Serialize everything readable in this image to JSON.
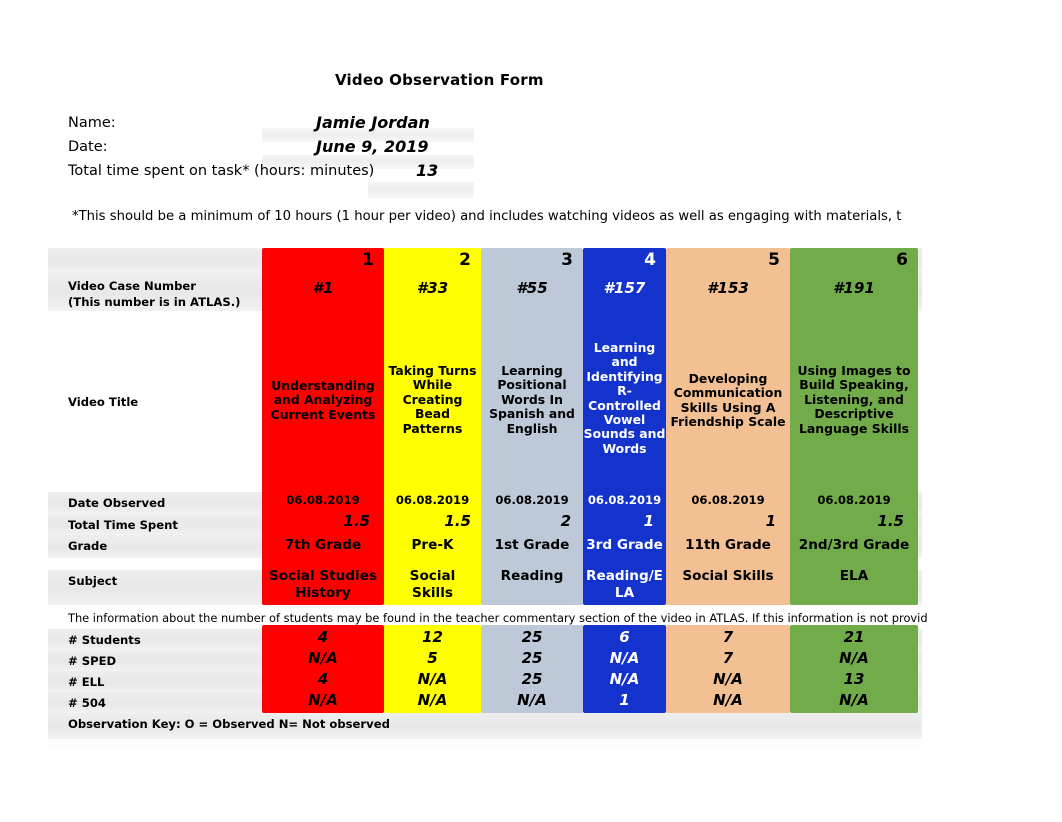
{
  "header": {
    "title": "Video Observation Form",
    "name_label": "Name:",
    "name_value": "Jamie Jordan",
    "date_label": "Date:",
    "date_value": "June 9, 2019",
    "time_label": "Total time spent on task* (hours: minutes)",
    "time_value": "13",
    "footnote": "*This should be a minimum of 10 hours (1 hour per video) and includes watching videos as well as engaging with materials, t"
  },
  "table": {
    "row_labels": {
      "case_number_l1": "Video Case Number",
      "case_number_l2": "(This number is in ATLAS.)",
      "video_title": "Video Title",
      "date_observed": "Date Observed",
      "total_time_spent": "Total Time Spent",
      "grade": "Grade",
      "subject": "Subject",
      "students_note": "The information about the number of students may be found in the teacher commentary section of the video in ATLAS. If this information is not provided, ple",
      "students": "# Students",
      "sped": "# SPED",
      "ell": "# ELL",
      "f504": "# 504",
      "observation_key": "Observation Key: O = Observed N= Not observed"
    },
    "columns": [
      {
        "number": "1",
        "color": "#fe0000",
        "text_color": "#000000",
        "case_number": "#1",
        "video_title": "Understanding\nand Analyzing\nCurrent Events",
        "date_observed": "06.08.2019",
        "total_time_spent": "1.5",
        "grade": "7th Grade",
        "subject": "Social Studies\nHistory",
        "students": "4",
        "sped": "N/A",
        "ell": "4",
        "f504": "N/A"
      },
      {
        "number": "2",
        "color": "#ffff00",
        "text_color": "#000000",
        "case_number": "#33",
        "video_title": "Taking Turns\nWhile\nCreating\nBead\nPatterns",
        "date_observed": "06.08.2019",
        "total_time_spent": "1.5",
        "grade": "Pre-K",
        "subject": "Social\nSkills",
        "students": "12",
        "sped": "5",
        "ell": "N/A",
        "f504": "N/A"
      },
      {
        "number": "3",
        "color": "#bdc8d8",
        "text_color": "#000000",
        "case_number": "#55",
        "video_title": "Learning\nPositional\nWords In\nSpanish and\nEnglish",
        "date_observed": "06.08.2019",
        "total_time_spent": "2",
        "grade": "1st Grade",
        "subject": "Reading",
        "students": "25",
        "sped": "25",
        "ell": "25",
        "f504": "N/A"
      },
      {
        "number": "4",
        "color": "#1433cc",
        "text_color": "#ffffff",
        "case_number": "#157",
        "video_title": "Learning\nand\nIdentifying\nR-\nControlled\nVowel\nSounds and\nWords",
        "date_observed": "06.08.2019",
        "total_time_spent": "1",
        "grade": "3rd Grade",
        "subject": "Reading/E\nLA",
        "students": "6",
        "sped": "N/A",
        "ell": "N/A",
        "f504": "1"
      },
      {
        "number": "5",
        "color": "#f3c093",
        "text_color": "#000000",
        "case_number": "#153",
        "video_title": "Developing\nCommunication\nSkills Using A\nFriendship Scale",
        "date_observed": "06.08.2019",
        "total_time_spent": "1",
        "grade": "11th Grade",
        "subject": "Social Skills",
        "students": "7",
        "sped": "7",
        "ell": "N/A",
        "f504": "N/A"
      },
      {
        "number": "6",
        "color": "#72ab49",
        "text_color": "#000000",
        "case_number": "#191",
        "video_title": "Using Images to\nBuild Speaking,\nListening, and\nDescriptive\nLanguage Skills",
        "date_observed": "06.08.2019",
        "total_time_spent": "1.5",
        "grade": "2nd/3rd Grade",
        "subject": "ELA",
        "students": "21",
        "sped": "N/A",
        "ell": "13",
        "f504": "N/A"
      }
    ]
  }
}
